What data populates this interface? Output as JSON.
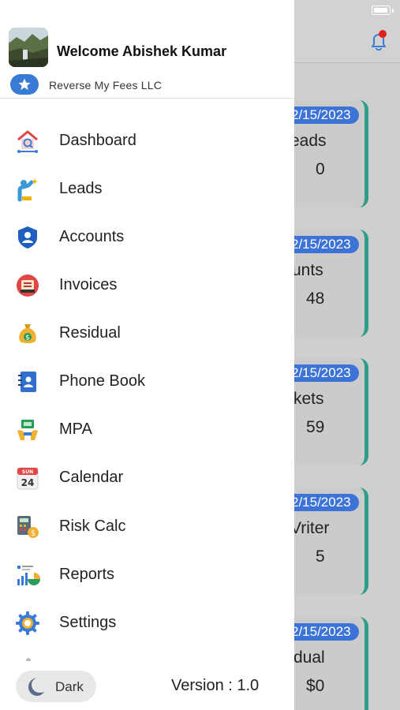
{
  "header": {
    "welcome": "Welcome Abishek Kumar",
    "company": "Reverse My Fees LLC"
  },
  "menu": [
    {
      "label": "Dashboard",
      "icon": "dashboard-icon"
    },
    {
      "label": "Leads",
      "icon": "leads-icon"
    },
    {
      "label": "Accounts",
      "icon": "accounts-shield-icon"
    },
    {
      "label": "Invoices",
      "icon": "invoices-icon"
    },
    {
      "label": "Residual",
      "icon": "money-bag-icon"
    },
    {
      "label": "Phone Book",
      "icon": "phone-book-icon"
    },
    {
      "label": "MPA",
      "icon": "mpa-icon"
    },
    {
      "label": "Calendar",
      "icon": "calendar-icon"
    },
    {
      "label": "Risk Calc",
      "icon": "risk-calc-icon"
    },
    {
      "label": "Reports",
      "icon": "reports-icon"
    },
    {
      "label": "Settings",
      "icon": "gear-icon"
    }
  ],
  "calendar_icon": {
    "month": "SUN",
    "day": "24"
  },
  "footer": {
    "dark_label": "Dark",
    "version": "Version : 1.0"
  },
  "background_cards": [
    {
      "date": "2/15/2023",
      "title": "eads",
      "value": "0"
    },
    {
      "date": "2/15/2023",
      "title": "unts",
      "value": "48"
    },
    {
      "date": "2/15/2023",
      "title": "kets",
      "value": "59"
    },
    {
      "date": "2/15/2023",
      "title": "Vriter",
      "value": "5"
    },
    {
      "date": "2/15/2023",
      "title": "dual",
      "value": "$0"
    }
  ],
  "colors": {
    "accent": "#3a7bd5",
    "card_border": "#2f9d8a",
    "date_pill": "#3d73d6",
    "notification_dot": "#e02020"
  }
}
